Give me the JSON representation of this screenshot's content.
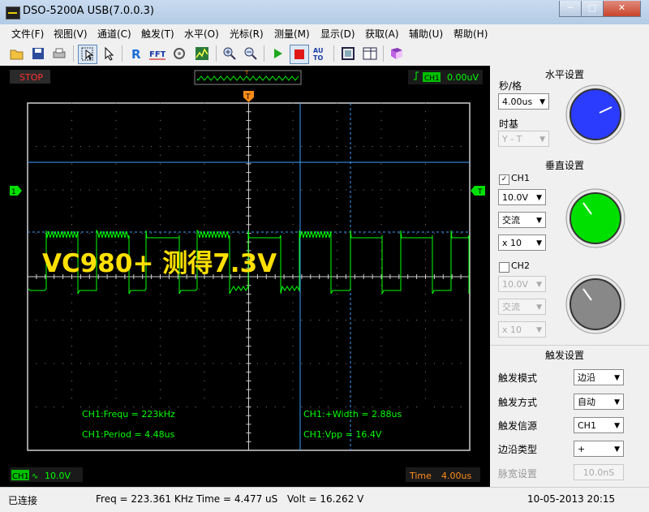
{
  "window": {
    "title": "DSO-5200A USB(7.0.0.3)",
    "minimize": "─",
    "maximize": "□",
    "close": "✕"
  },
  "menu": [
    "文件(F)",
    "视图(V)",
    "通道(C)",
    "触发(T)",
    "水平(O)",
    "光标(R)",
    "测量(M)",
    "显示(D)",
    "获取(A)",
    "辅助(U)",
    "帮助(H)"
  ],
  "toolbar_icons": [
    "open-folder-icon",
    "save-icon",
    "print-icon",
    "select-cursor-icon",
    "pointer-icon",
    "reference-icon",
    "fft-icon",
    "probe-icon",
    "math-icon",
    "zoom-in-icon",
    "zoom-out-icon",
    "run-icon",
    "stop-icon",
    "auto-icon",
    "screenshot-icon",
    "layout-icon",
    "book-icon"
  ],
  "scope": {
    "run_state": "STOP",
    "trigger_marker": "T",
    "trigger_source": "CH1",
    "trigger_level": "0.00uV",
    "ch1_marker": "1",
    "trigger_level_marker": "T",
    "overlay_text": "VC980+ 测得7.3V",
    "measurements": {
      "frequency": "CH1:Frequ = 223kHz",
      "period": "CH1:Period = 4.48us",
      "width": "CH1:+Width = 2.88us",
      "vpp": "CH1:Vpp = 16.4V"
    },
    "ch1_label": "CH1",
    "ch1_scale": "10.0V",
    "time_label": "Time",
    "time_scale": "4.00us"
  },
  "horizontal": {
    "title": "水平设置",
    "sec_div_label": "秒/格",
    "sec_div_value": "4.00us",
    "timebase_label": "时基",
    "timebase_value": "Y - T"
  },
  "vertical": {
    "title": "垂直设置",
    "ch1_label": "CH1",
    "ch1_volt": "10.0V",
    "ch1_coupling": "交流",
    "ch1_probe": "x 10",
    "ch2_label": "CH2",
    "ch2_volt": "10.0V",
    "ch2_coupling": "交流",
    "ch2_probe": "x 10"
  },
  "trigger": {
    "title": "触发设置",
    "mode_label": "触发模式",
    "mode_value": "边沿",
    "sweep_label": "触发方式",
    "sweep_value": "自动",
    "source_label": "触发信源",
    "source_value": "CH1",
    "slope_label": "边沿类型",
    "slope_value": "+",
    "pulse_label": "脉宽设置",
    "pulse_value": "10.0nS"
  },
  "colors": {
    "ch1": "#00ff00",
    "horizontal_knob": "#2b3cff",
    "ch1_knob": "#00e000",
    "ch2_knob": "#888888",
    "measure_text": "#00ff00",
    "overlay_text": "#ffe000",
    "cursor": "#3aa0ff"
  },
  "status": {
    "connection": "已连接",
    "freq_time": "Freq = 223.361 KHz  Time = 4.477 uS",
    "volt": "Volt = 16.262 V",
    "datetime": "10-05-2013  20:15"
  }
}
